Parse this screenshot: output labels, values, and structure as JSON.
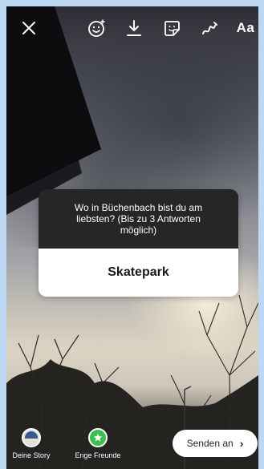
{
  "toolbar": {
    "close_icon": "close-icon",
    "emoji_icon": "emoji-effects-icon",
    "download_icon": "download-icon",
    "sticker_icon": "sticker-icon",
    "draw_icon": "draw-icon",
    "text_label": "Aa"
  },
  "poll": {
    "question": "Wo in Büchenbach bist du am liebsten? (Bis zu 3 Antworten möglich)",
    "answer": "Skatepark"
  },
  "bottom": {
    "your_story_label": "Deine Story",
    "close_friends_label": "Enge Freunde",
    "send_label": "Senden an",
    "send_chevron": "›"
  },
  "colors": {
    "poll_header": "#262626",
    "close_friends_green": "#3fbf4f",
    "page_background": "#bcd8f2"
  }
}
